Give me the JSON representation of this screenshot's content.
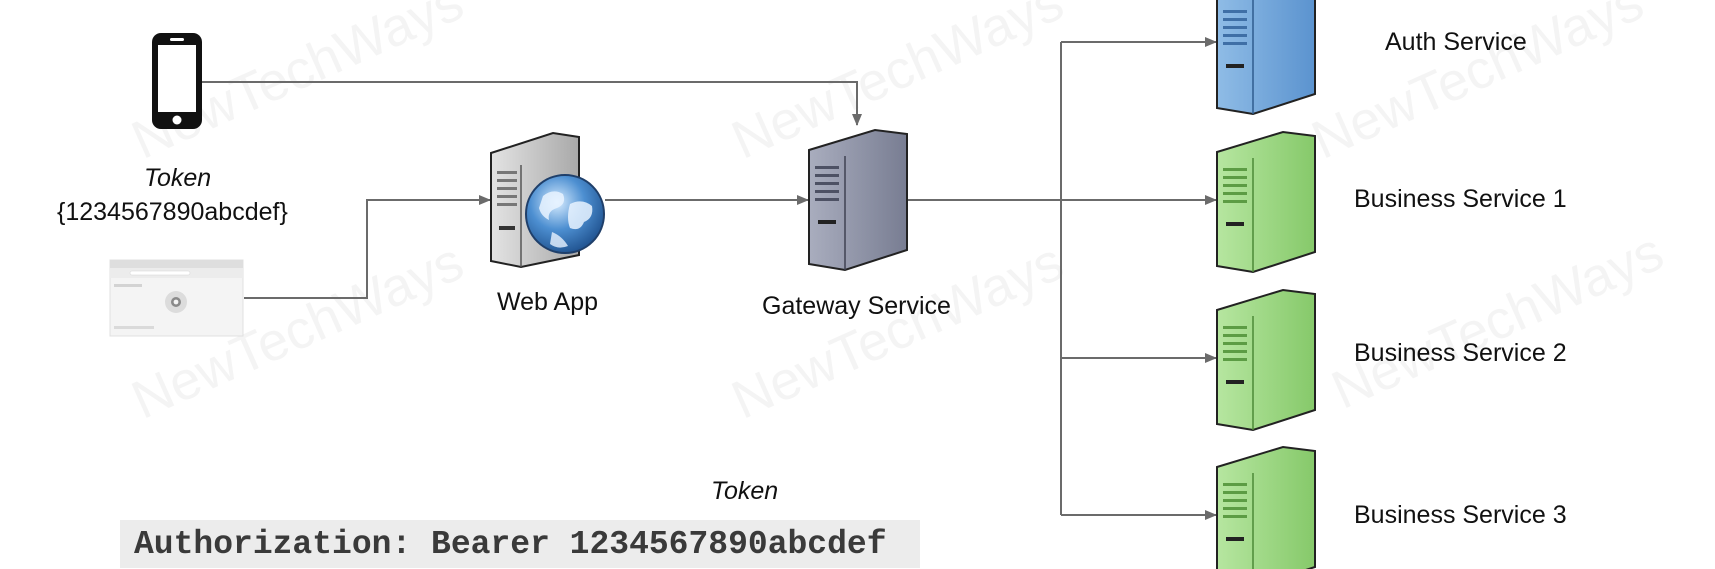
{
  "nodes": {
    "mobile_token_label": "Token",
    "mobile_token_value": "{1234567890abcdef}",
    "web_app": "Web App",
    "gateway": "Gateway Service",
    "auth": "Auth Service",
    "business_1": "Business Service 1",
    "business_2": "Business Service 2",
    "business_3": "Business Service 3"
  },
  "request": {
    "token_label": "Token",
    "header": "Authorization: Bearer 1234567890abcdef"
  },
  "watermark": "NewTechWays",
  "colors": {
    "auth_server": "#6fa7dc",
    "business_server": "#9ed784",
    "gateway_server": "#8e93a6",
    "web_server": "#c9c9c9",
    "arrow": "#6b6b6b"
  }
}
